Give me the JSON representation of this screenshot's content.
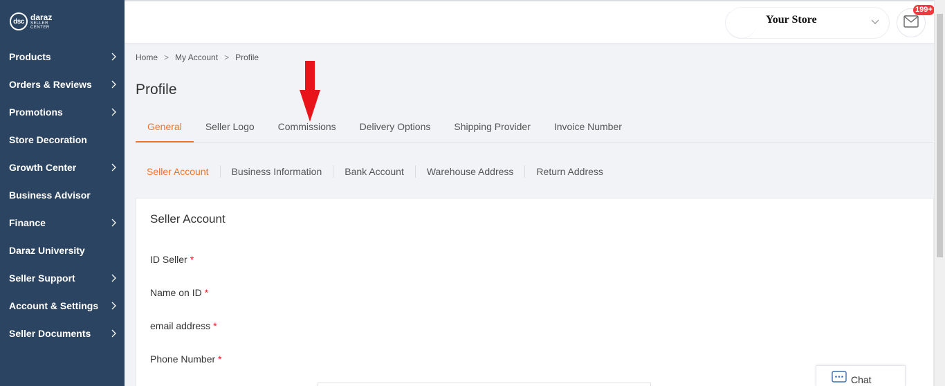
{
  "logo": {
    "mark": "dsc",
    "line1": "daraz",
    "line2": "SELLER",
    "line3": "CENTER"
  },
  "sidebar": {
    "items": [
      {
        "label": "Products",
        "has_chevron": true
      },
      {
        "label": "Orders & Reviews",
        "has_chevron": true
      },
      {
        "label": "Promotions",
        "has_chevron": true
      },
      {
        "label": "Store Decoration",
        "has_chevron": false
      },
      {
        "label": "Growth Center",
        "has_chevron": true
      },
      {
        "label": "Business Advisor",
        "has_chevron": false
      },
      {
        "label": "Finance",
        "has_chevron": true
      },
      {
        "label": "Daraz University",
        "has_chevron": false
      },
      {
        "label": "Seller Support",
        "has_chevron": true
      },
      {
        "label": "Account & Settings",
        "has_chevron": true
      },
      {
        "label": "Seller Documents",
        "has_chevron": true
      }
    ]
  },
  "header": {
    "store_name": "Your Store",
    "mail_badge": "199+",
    "icons": {
      "dropdown": "chevron-down-icon",
      "mail": "mail-icon"
    }
  },
  "breadcrumb": {
    "items": [
      "Home",
      "My Account",
      "Profile"
    ],
    "separator": ">"
  },
  "page": {
    "title": "Profile"
  },
  "tabs": {
    "items": [
      "General",
      "Seller Logo",
      "Commissions",
      "Delivery Options",
      "Shipping Provider",
      "Invoice Number"
    ],
    "active": "General"
  },
  "subtabs": {
    "items": [
      "Seller Account",
      "Business Information",
      "Bank Account",
      "Warehouse Address",
      "Return Address"
    ],
    "active": "Seller Account"
  },
  "card": {
    "title": "Seller Account",
    "fields": [
      {
        "label": "ID Seller",
        "required_mark": "*"
      },
      {
        "label": "Name on ID",
        "required_mark": "*"
      },
      {
        "label": "email address",
        "required_mark": "*"
      },
      {
        "label": "Phone Number",
        "required_mark": "*"
      }
    ]
  },
  "chat": {
    "label": "Chat"
  },
  "colors": {
    "sidebar": "#2b4462",
    "accent": "#f57224",
    "arrow": "#e8141a",
    "badge": "#f0393f"
  }
}
